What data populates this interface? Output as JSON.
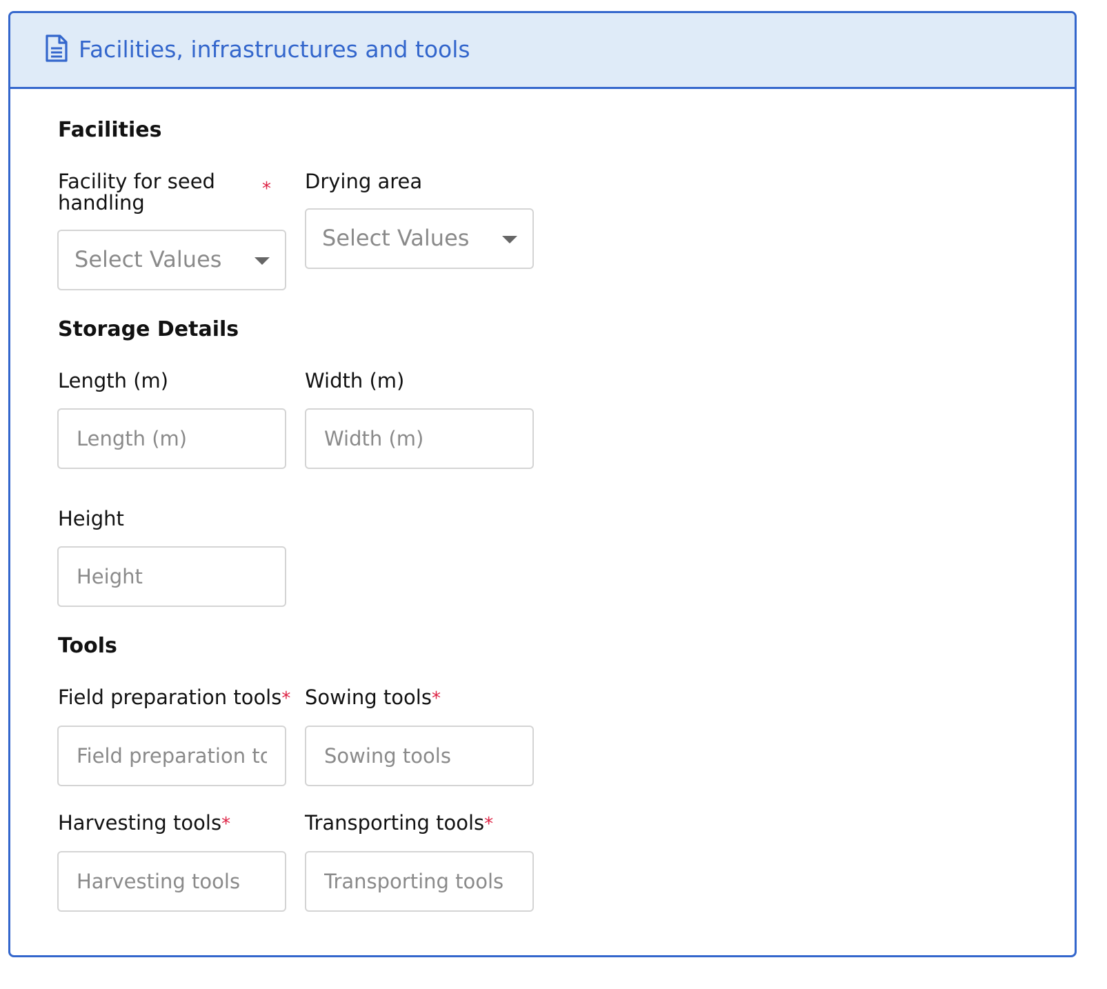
{
  "header": {
    "title": "Facilities, infrastructures and tools",
    "icon": "document-icon",
    "color": "#3366cc",
    "background": "#dfebf8"
  },
  "facilities": {
    "title": "Facilities",
    "seed_handling": {
      "label_line1": "Facility for seed",
      "label_line2": "handling",
      "required": "*",
      "placeholder": "Select Values"
    },
    "drying_area": {
      "label": "Drying area",
      "placeholder": "Select Values"
    }
  },
  "storage": {
    "title": "Storage Details",
    "length": {
      "label": "Length (m)",
      "placeholder": "Length (m)"
    },
    "width": {
      "label": "Width (m)",
      "placeholder": "Width (m)"
    },
    "height": {
      "label": "Height",
      "placeholder": "Height"
    }
  },
  "tools": {
    "title": "Tools",
    "field_preparation": {
      "label": "Field preparation tools",
      "required": "*",
      "placeholder": "Field preparation tools"
    },
    "sowing": {
      "label": "Sowing tools",
      "required": "*",
      "placeholder": "Sowing tools"
    },
    "harvesting": {
      "label": "Harvesting tools",
      "required": "*",
      "placeholder": "Harvesting tools"
    },
    "transporting": {
      "label": "Transporting tools",
      "required": "*",
      "placeholder": "Transporting tools"
    }
  },
  "colors": {
    "accent": "#3366cc",
    "required": "#dd2244",
    "input_border": "#d4d4d4",
    "placeholder": "#8a8a8a"
  }
}
